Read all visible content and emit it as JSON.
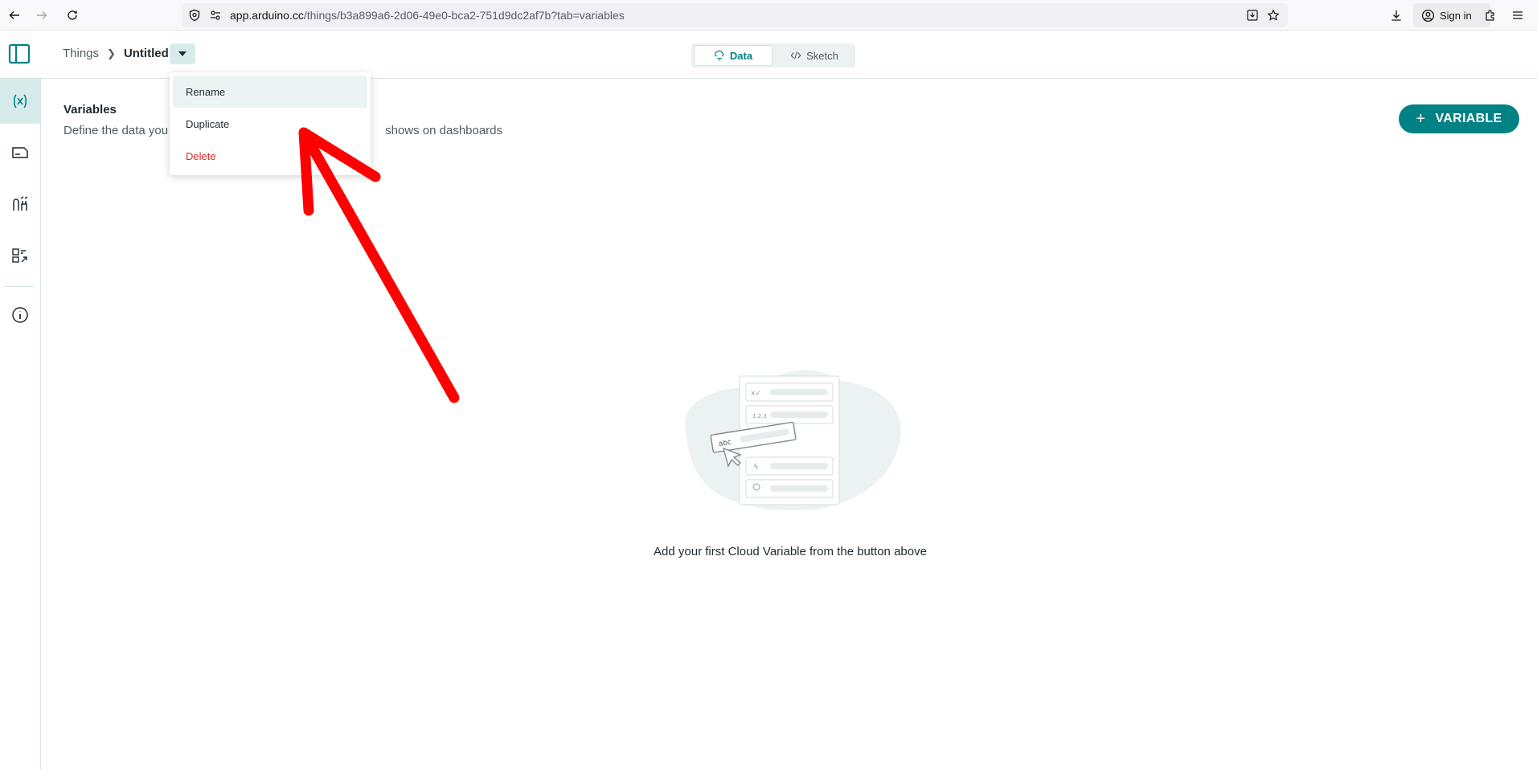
{
  "browser": {
    "url_domain": "app.arduino.cc",
    "url_path": "/things/b3a899a6-2d06-49e0-bca2-751d9dc2af7b?tab=variables",
    "signin_label": "Sign in"
  },
  "header": {
    "breadcrumb_root": "Things",
    "breadcrumb_current": "Untitled",
    "tabs": [
      {
        "label": "Data",
        "active": true
      },
      {
        "label": "Sketch",
        "active": false
      }
    ]
  },
  "sidebar": {
    "items": [
      {
        "icon": "variables-icon",
        "active": true
      },
      {
        "icon": "device-icon",
        "active": false
      },
      {
        "icon": "network-icon",
        "active": false
      },
      {
        "icon": "dashboard-link-icon",
        "active": false
      },
      {
        "icon": "info-icon",
        "active": false
      }
    ]
  },
  "main": {
    "section_title": "Variables",
    "section_desc_start": "Define the data you",
    "section_desc_end": "shows on dashboards",
    "add_variable_label": "VARIABLE",
    "empty_state_text": "Add your first Cloud Variable from the button above",
    "illustration_labels": {
      "numeric": "1.2.3",
      "text": "abc"
    }
  },
  "menu": {
    "items": [
      {
        "label": "Rename",
        "highlighted": true
      },
      {
        "label": "Duplicate",
        "highlighted": false
      },
      {
        "label": "Delete",
        "highlighted": false,
        "danger": true
      }
    ]
  },
  "colors": {
    "brand": "#008184",
    "brand_light": "#d7ecea",
    "danger": "#da2a2a",
    "annotation_arrow": "#ff0000"
  }
}
